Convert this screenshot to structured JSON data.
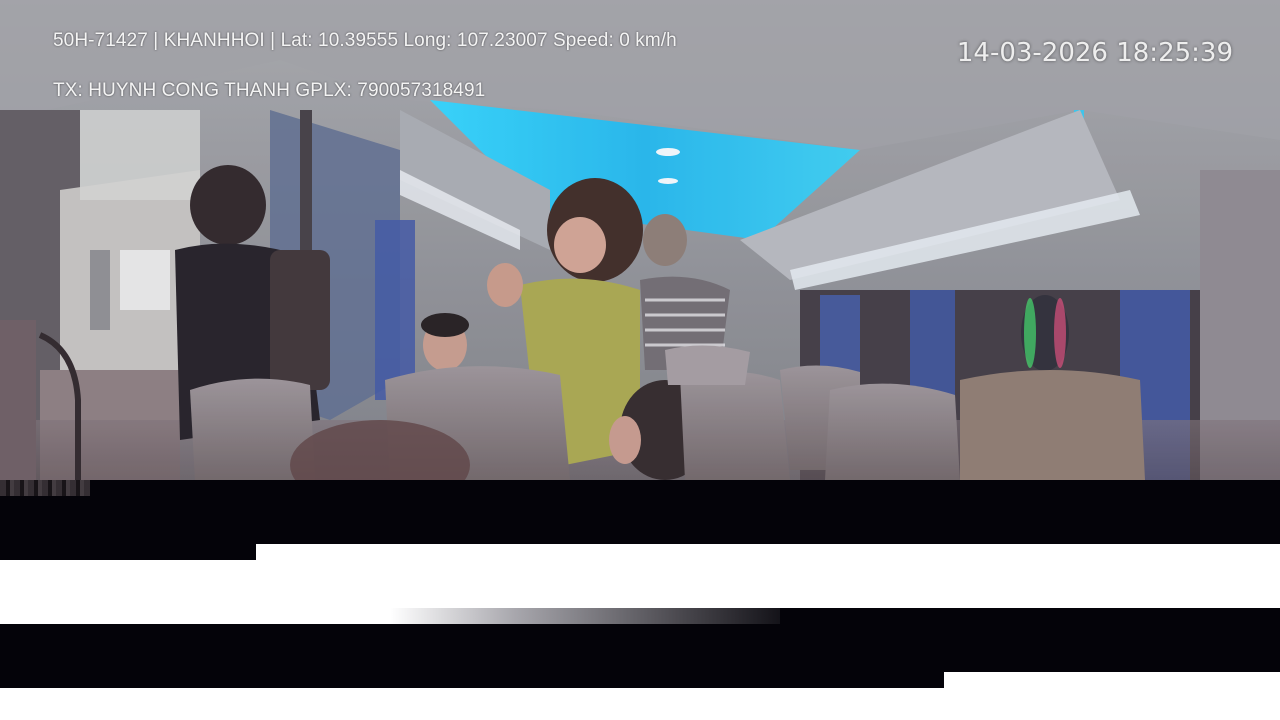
{
  "overlay": {
    "gps_line": "50H-71427 | KHANHHOI | Lat: 10.39555 Long: 107.23007 Speed: 0 km/h",
    "driver_line": "TX: HUYNH CONG THANH GPLX: 790057318491",
    "timestamp": "14-03-2026 18:25:39"
  },
  "scene": {
    "description_icon": "bus-interior-camera-icon"
  },
  "colors": {
    "overlay_text": "#f4f4f4",
    "ceiling_light": "#2ec9f0",
    "glitch_band": "#040309",
    "background": "#ffffff"
  }
}
